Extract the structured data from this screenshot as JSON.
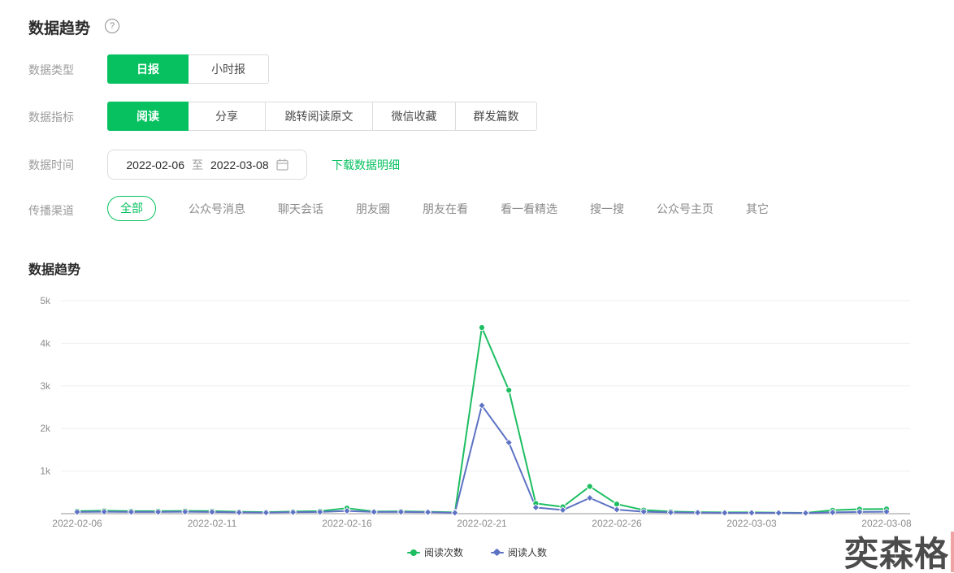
{
  "page": {
    "title": "数据趋势",
    "help_glyph": "?"
  },
  "filters": {
    "data_type": {
      "label": "数据类型",
      "options": [
        {
          "label": "日报",
          "selected": true
        },
        {
          "label": "小时报",
          "selected": false
        }
      ]
    },
    "data_metric": {
      "label": "数据指标",
      "options": [
        {
          "label": "阅读",
          "selected": true
        },
        {
          "label": "分享",
          "selected": false
        },
        {
          "label": "跳转阅读原文",
          "selected": false
        },
        {
          "label": "微信收藏",
          "selected": false
        },
        {
          "label": "群发篇数",
          "selected": false
        }
      ]
    },
    "data_time": {
      "label": "数据时间",
      "start": "2022-02-06",
      "to_label": "至",
      "end": "2022-03-08",
      "download_link": "下载数据明细"
    },
    "channel": {
      "label": "传播渠道",
      "options": [
        {
          "label": "全部",
          "selected": true
        },
        {
          "label": "公众号消息",
          "selected": false
        },
        {
          "label": "聊天会话",
          "selected": false
        },
        {
          "label": "朋友圈",
          "selected": false
        },
        {
          "label": "朋友在看",
          "selected": false
        },
        {
          "label": "看一看精选",
          "selected": false
        },
        {
          "label": "搜一搜",
          "selected": false
        },
        {
          "label": "公众号主页",
          "selected": false
        },
        {
          "label": "其它",
          "selected": false
        }
      ]
    }
  },
  "chart": {
    "section_title": "数据趋势"
  },
  "chart_data": {
    "type": "line",
    "title": "数据趋势",
    "x": [
      "2022-02-06",
      "2022-02-07",
      "2022-02-08",
      "2022-02-09",
      "2022-02-10",
      "2022-02-11",
      "2022-02-12",
      "2022-02-13",
      "2022-02-14",
      "2022-02-15",
      "2022-02-16",
      "2022-02-17",
      "2022-02-18",
      "2022-02-19",
      "2022-02-20",
      "2022-02-21",
      "2022-02-22",
      "2022-02-23",
      "2022-02-24",
      "2022-02-25",
      "2022-02-26",
      "2022-02-27",
      "2022-02-28",
      "2022-03-01",
      "2022-03-02",
      "2022-03-03",
      "2022-03-04",
      "2022-03-05",
      "2022-03-06",
      "2022-03-07",
      "2022-03-08"
    ],
    "x_tick_labels": [
      "2022-02-06",
      "2022-02-11",
      "2022-02-16",
      "2022-02-21",
      "2022-02-26",
      "2022-03-03",
      "2022-03-08"
    ],
    "x_tick_every": 5,
    "series": [
      {
        "name": "阅读次数",
        "color": "#1dbe62",
        "marker": "circle",
        "values": [
          60,
          70,
          60,
          60,
          65,
          60,
          45,
          35,
          50,
          60,
          130,
          50,
          55,
          45,
          30,
          4370,
          2900,
          240,
          160,
          640,
          225,
          85,
          50,
          35,
          30,
          30,
          25,
          20,
          80,
          105,
          110
        ]
      },
      {
        "name": "阅读人数",
        "color": "#5e72c4",
        "marker": "diamond",
        "values": [
          40,
          45,
          40,
          40,
          45,
          40,
          30,
          25,
          35,
          40,
          65,
          40,
          40,
          35,
          20,
          2540,
          1670,
          145,
          85,
          370,
          95,
          45,
          30,
          25,
          20,
          20,
          18,
          15,
          30,
          40,
          45
        ]
      }
    ],
    "ylim": [
      0,
      5000
    ],
    "y_ticks": [
      "1k",
      "2k",
      "3k",
      "4k",
      "5k"
    ],
    "grid": true,
    "legend_position": "bottom"
  },
  "watermark": {
    "text": "奕森格"
  },
  "colors": {
    "accent_green": "#07C160",
    "line_green": "#1dbe62",
    "line_blue": "#5e72c4",
    "grid_line": "#efefef",
    "axis_base": "#c9c9c9",
    "axis_text": "#8c8c8c"
  }
}
